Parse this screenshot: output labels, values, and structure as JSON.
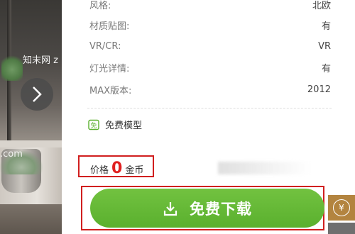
{
  "viewer": {
    "watermark_top": "知末网 z",
    "watermark_bottom": ".com"
  },
  "details": [
    {
      "label": "风格:",
      "value": "北欧"
    },
    {
      "label": "材质贴图:",
      "value": "有"
    },
    {
      "label": "VR/CR:",
      "value": "VR"
    },
    {
      "label": "灯光详情:",
      "value": "有"
    },
    {
      "label": "MAX版本:",
      "value": "2012"
    }
  ],
  "free_model_label": "免费模型",
  "price": {
    "label": "价格",
    "amount": "0",
    "unit": "金币"
  },
  "download_button_label": "免费下载",
  "side_coin_symbol": "¥",
  "colors": {
    "primary_green": "#5ab02e",
    "highlight_red": "#d11f1f",
    "side_tab_gold": "#b3843f"
  }
}
